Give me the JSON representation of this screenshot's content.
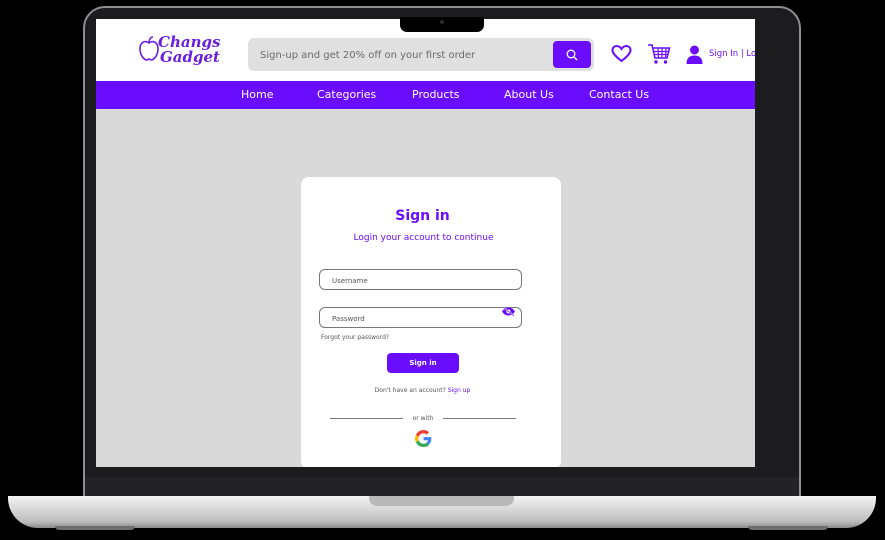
{
  "header": {
    "logo_line1": "Changs",
    "logo_line2": "Gadget",
    "search_placeholder": "Sign-up and get 20% off on your first order",
    "signin_link": "Sign In | Log"
  },
  "nav": {
    "items": [
      "Home",
      "Categories",
      "Products",
      "About Us",
      "Contact Us"
    ]
  },
  "signin": {
    "title": "Sign in",
    "subtitle": "Login your account to continue",
    "username_placeholder": "Username",
    "password_placeholder": "Password",
    "forgot": "Forgot your password?",
    "button": "Sign in",
    "no_account": "Don't have an account?",
    "signup_link": "Sign up",
    "or_with": "or with"
  },
  "colors": {
    "brand": "#6a0dff",
    "page_bg": "#d9d9d9"
  }
}
